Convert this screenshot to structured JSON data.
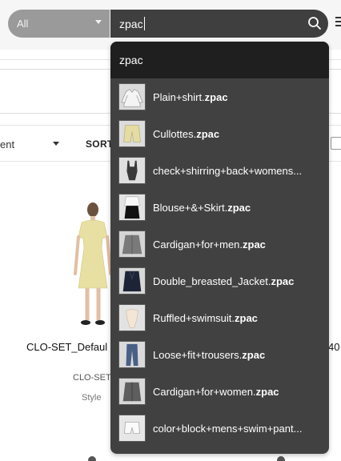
{
  "search": {
    "filter_value": "All",
    "query": "zpac"
  },
  "page": {
    "sort_select_value": "ent",
    "sort_label": "SORT",
    "card": {
      "title": "CLO-SET_Defaul",
      "title_right": "40",
      "subtitle": "CLO-SET",
      "meta": "Style"
    }
  },
  "dropdown": {
    "header": "zpac",
    "items": [
      {
        "name": "Plain+shirt.",
        "ext": "zpac",
        "thumb": "shirt"
      },
      {
        "name": "Cullottes.",
        "ext": "zpac",
        "thumb": "shorts"
      },
      {
        "name": "check+shirring+back+womens...",
        "ext": "",
        "thumb": "swimsuit-check"
      },
      {
        "name": "Blouse+&+Skirt.",
        "ext": "zpac",
        "thumb": "blouse-skirt"
      },
      {
        "name": "Cardigan+for+men.",
        "ext": "zpac",
        "thumb": "cardigan-men"
      },
      {
        "name": "Double_breasted_Jacket.",
        "ext": "zpac",
        "thumb": "jacket"
      },
      {
        "name": "Ruffled+swimsuit.",
        "ext": "zpac",
        "thumb": "ruffled-swimsuit"
      },
      {
        "name": "Loose+fit+trousers.",
        "ext": "zpac",
        "thumb": "trousers"
      },
      {
        "name": "Cardigan+for+women.",
        "ext": "zpac",
        "thumb": "cardigan-women"
      },
      {
        "name": "color+block+mens+swim+pant...",
        "ext": "",
        "thumb": "swim-pants"
      }
    ]
  },
  "colors": {
    "dropdown_bg": "#414141",
    "dropdown_header_bg": "#1f1f1f",
    "search_bg": "#3f3f3f",
    "filter_bg": "#9a9a9a"
  }
}
